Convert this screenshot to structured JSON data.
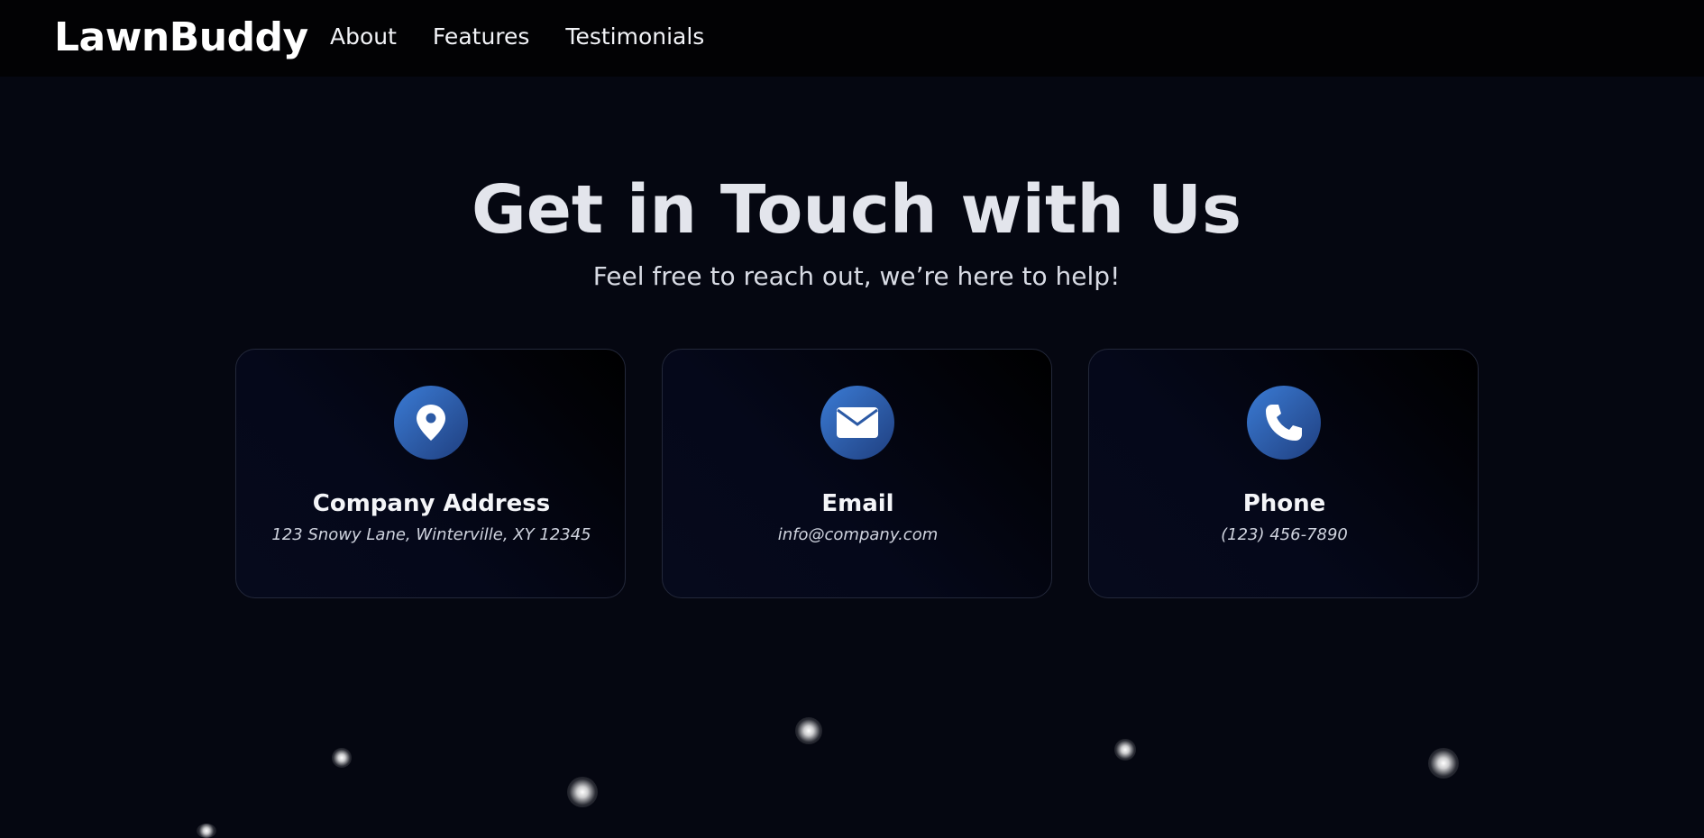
{
  "header": {
    "logo": "LawnBuddy",
    "nav": [
      "About",
      "Features",
      "Testimonials"
    ]
  },
  "hero": {
    "title": "Get in Touch with Us",
    "subtitle": "Feel free to reach out, we’re here to help!"
  },
  "cards": [
    {
      "icon": "map-pin-icon",
      "title": "Company Address",
      "detail": "123 Snowy Lane, Winterville, XY 12345"
    },
    {
      "icon": "envelope-icon",
      "title": "Email",
      "detail": "info@company.com"
    },
    {
      "icon": "phone-icon",
      "title": "Phone",
      "detail": "(123) 456-7890"
    }
  ],
  "colors": {
    "background": "#050711",
    "header_bg": "#020204",
    "icon_gradient_start": "#3a7bd5",
    "icon_gradient_end": "#1f3f80"
  }
}
